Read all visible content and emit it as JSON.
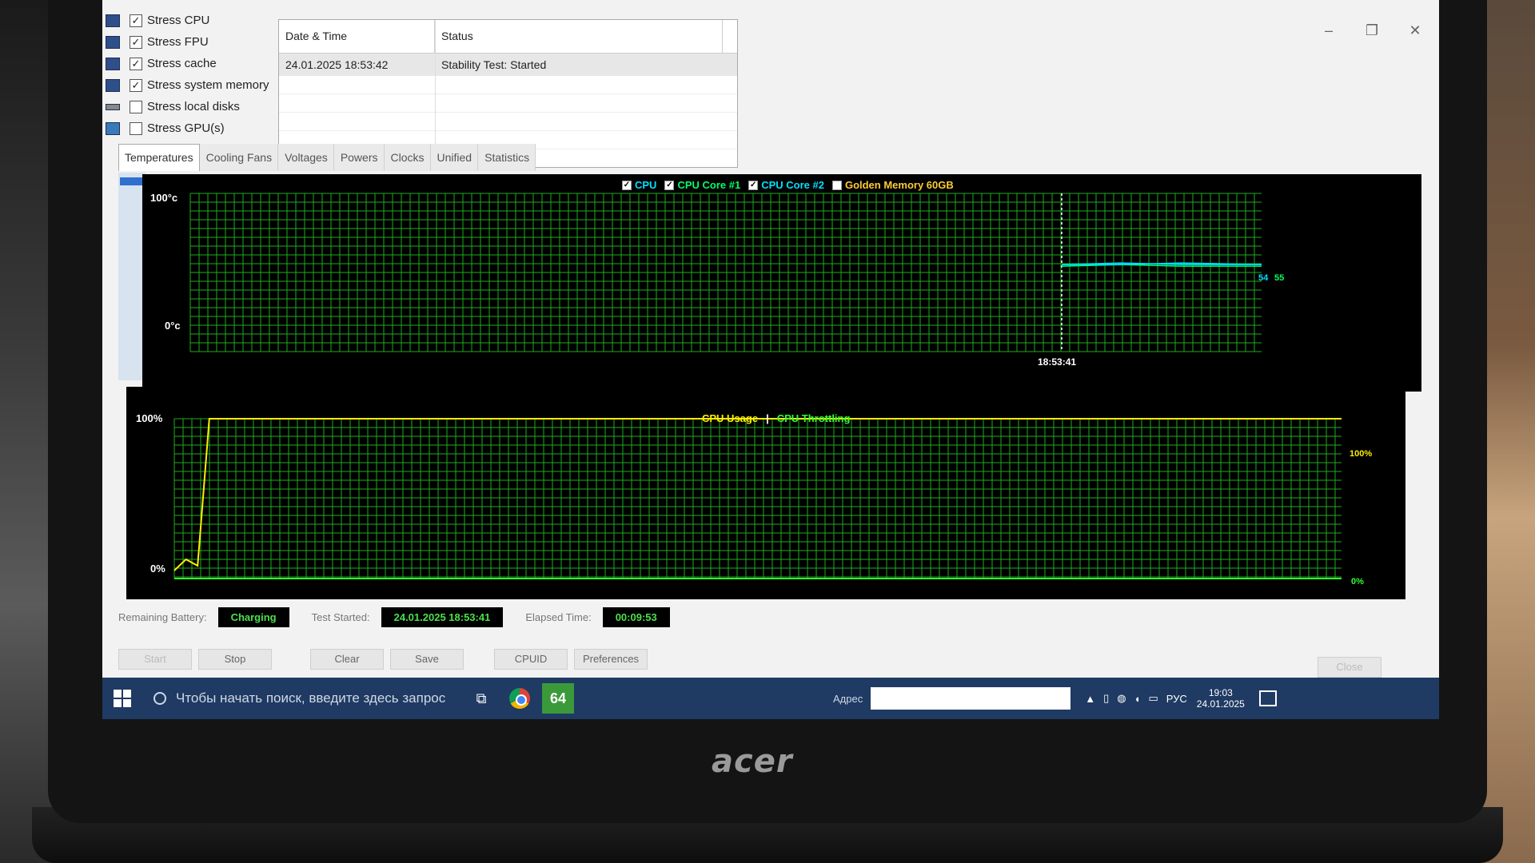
{
  "window": {
    "minimize": "–",
    "maximize": "❐",
    "close": "✕"
  },
  "stress_options": [
    {
      "label": "Stress CPU",
      "checked": true,
      "icon": "cpu-icon"
    },
    {
      "label": "Stress FPU",
      "checked": true,
      "icon": "fpu-icon"
    },
    {
      "label": "Stress cache",
      "checked": true,
      "icon": "cache-icon"
    },
    {
      "label": "Stress system memory",
      "checked": true,
      "icon": "memory-icon"
    },
    {
      "label": "Stress local disks",
      "checked": false,
      "icon": "disk-icon"
    },
    {
      "label": "Stress GPU(s)",
      "checked": false,
      "icon": "gpu-icon"
    }
  ],
  "log": {
    "col_datetime": "Date & Time",
    "col_status": "Status",
    "rows": [
      {
        "datetime": "24.01.2025 18:53:42",
        "status": "Stability Test: Started"
      }
    ]
  },
  "tabs": [
    "Temperatures",
    "Cooling Fans",
    "Voltages",
    "Powers",
    "Clocks",
    "Unified",
    "Statistics"
  ],
  "temp_graph": {
    "y_max_label": "100°c",
    "y_min_label": "0°c",
    "legend": [
      {
        "label": "CPU",
        "checked": true,
        "color": "#00e0ff"
      },
      {
        "label": "CPU Core #1",
        "checked": true,
        "color": "#00ff66"
      },
      {
        "label": "CPU Core #2",
        "checked": true,
        "color": "#00e0ff"
      },
      {
        "label": "Golden Memory 60GB",
        "checked": false,
        "color": "#ffcc33"
      }
    ],
    "time_label": "18:53:41",
    "value_label_1": "54",
    "value_label_2": "55"
  },
  "cpu_graph": {
    "y_max_label": "100%",
    "y_min_label": "0%",
    "legend_usage": "CPU Usage",
    "legend_sep": "|",
    "legend_throttling": "CPU Throttling",
    "right_max_label": "100%",
    "right_min_label": "0%"
  },
  "chart_data": [
    {
      "type": "line",
      "ylim": [
        0,
        100
      ],
      "series": [
        {
          "name": "CPU",
          "color": "#00e0ff",
          "points": [
            [
              0.0,
              55
            ],
            [
              0.3,
              56
            ],
            [
              0.6,
              55
            ],
            [
              1.0,
              55
            ]
          ]
        },
        {
          "name": "CPU Core #1",
          "color": "#00ff66",
          "points": [
            [
              0.0,
              54
            ],
            [
              0.3,
              55
            ],
            [
              0.6,
              54
            ],
            [
              1.0,
              54
            ]
          ]
        },
        {
          "name": "CPU Core #2",
          "color": "#00e0ff",
          "points": [
            [
              0.0,
              55
            ],
            [
              0.3,
              55
            ],
            [
              0.6,
              56
            ],
            [
              1.0,
              55
            ]
          ]
        }
      ]
    },
    {
      "type": "line",
      "ylim": [
        0,
        100
      ],
      "series": [
        {
          "name": "CPU Usage",
          "color": "#ffee00",
          "points": [
            [
              0.0,
              5
            ],
            [
              0.01,
              12
            ],
            [
              0.02,
              8
            ],
            [
              0.03,
              100
            ],
            [
              1.0,
              100
            ]
          ]
        },
        {
          "name": "CPU Throttling",
          "color": "#33ff33",
          "points": [
            [
              0.0,
              0
            ],
            [
              1.0,
              0
            ]
          ]
        }
      ]
    }
  ],
  "status": {
    "battery_label": "Remaining Battery:",
    "battery_value": "Charging",
    "started_label": "Test Started:",
    "started_value": "24.01.2025 18:53:41",
    "elapsed_label": "Elapsed Time:",
    "elapsed_value": "00:09:53"
  },
  "buttons": {
    "start": "Start",
    "stop": "Stop",
    "clear": "Clear",
    "save": "Save",
    "cpuid": "CPUID",
    "preferences": "Preferences",
    "close": "Close"
  },
  "taskbar": {
    "search_placeholder": "Чтобы начать поиск, введите здесь запрос",
    "aida_label": "64",
    "address_label": "Адрес",
    "language": "РУС",
    "time": "19:03",
    "date": "24.01.2025"
  },
  "brand": "acer"
}
